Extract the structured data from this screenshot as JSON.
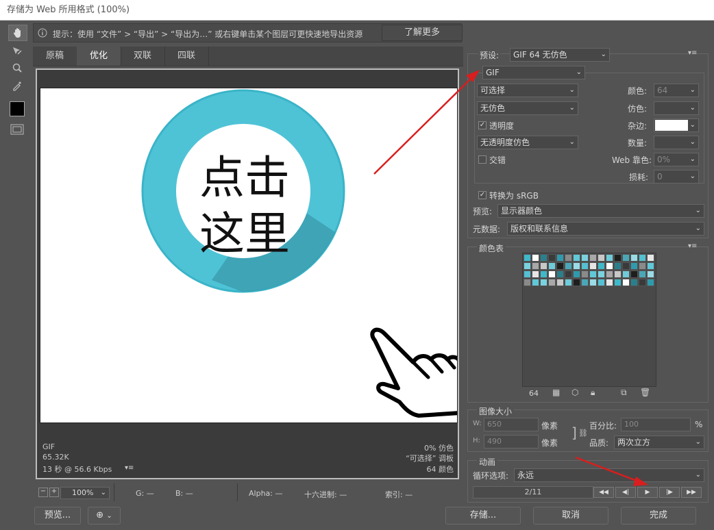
{
  "window": {
    "title": "存储为 Web 所用格式 (100%)"
  },
  "hint": {
    "text": "提示：使用 “文件” > “导出” > “导出为…” 或右键单击某个图层可更快速地导出资源",
    "button": "了解更多"
  },
  "tabs": [
    "原稿",
    "优化",
    "双联",
    "四联"
  ],
  "canvas": {
    "art_text_line1": "点击",
    "art_text_line2": "这里",
    "info_left": [
      "GIF",
      "65.32K",
      "13 秒 @ 56.6 Kbps"
    ],
    "info_right": [
      "0% 仿色",
      "“可选择” 调板",
      "64 颜色"
    ]
  },
  "status": {
    "zoom": "100%",
    "g": "G: —",
    "b": "B: —",
    "alpha": "Alpha: —",
    "hex": "十六进制: —",
    "index": "索引: —"
  },
  "bottom": {
    "preview": "预览...",
    "save": "存储...",
    "cancel": "取消",
    "done": "完成"
  },
  "settings": {
    "preset_label": "预设:",
    "preset_value": "GIF 64 无仿色",
    "format": "GIF",
    "reduction": "可选择",
    "dither_algo": "无仿色",
    "transparency": "透明度",
    "trans_dither": "无透明度仿色",
    "interlaced": "交错",
    "colors_label": "颜色:",
    "colors_value": "64",
    "dither_label": "仿色:",
    "matte_label": "杂边:",
    "amount_label": "数量:",
    "websnap_label": "Web 靠色:",
    "websnap_value": "0%",
    "lossy_label": "损耗:",
    "lossy_value": "0",
    "convert_srgb": "转换为 sRGB",
    "preview_label": "预览:",
    "preview_value": "显示器颜色",
    "metadata_label": "元数据:",
    "metadata_value": "版权和联系信息"
  },
  "color_table": {
    "title": "颜色表",
    "count": "64"
  },
  "image_size": {
    "title": "图像大小",
    "w_label": "W:",
    "w_value": "650",
    "w_unit": "像素",
    "h_label": "H:",
    "h_value": "490",
    "h_unit": "像素",
    "percent_label": "百分比:",
    "percent_value": "100",
    "percent_unit": "%",
    "quality_label": "品质:",
    "quality_value": "两次立方"
  },
  "animation": {
    "title": "动画",
    "loop_label": "循环选项:",
    "loop_value": "永远",
    "frame": "2/11"
  },
  "colors": {
    "teal": "#4fc3d6",
    "teal_dark": "#3b9fb0",
    "arrow_red": "#d81e1e"
  }
}
